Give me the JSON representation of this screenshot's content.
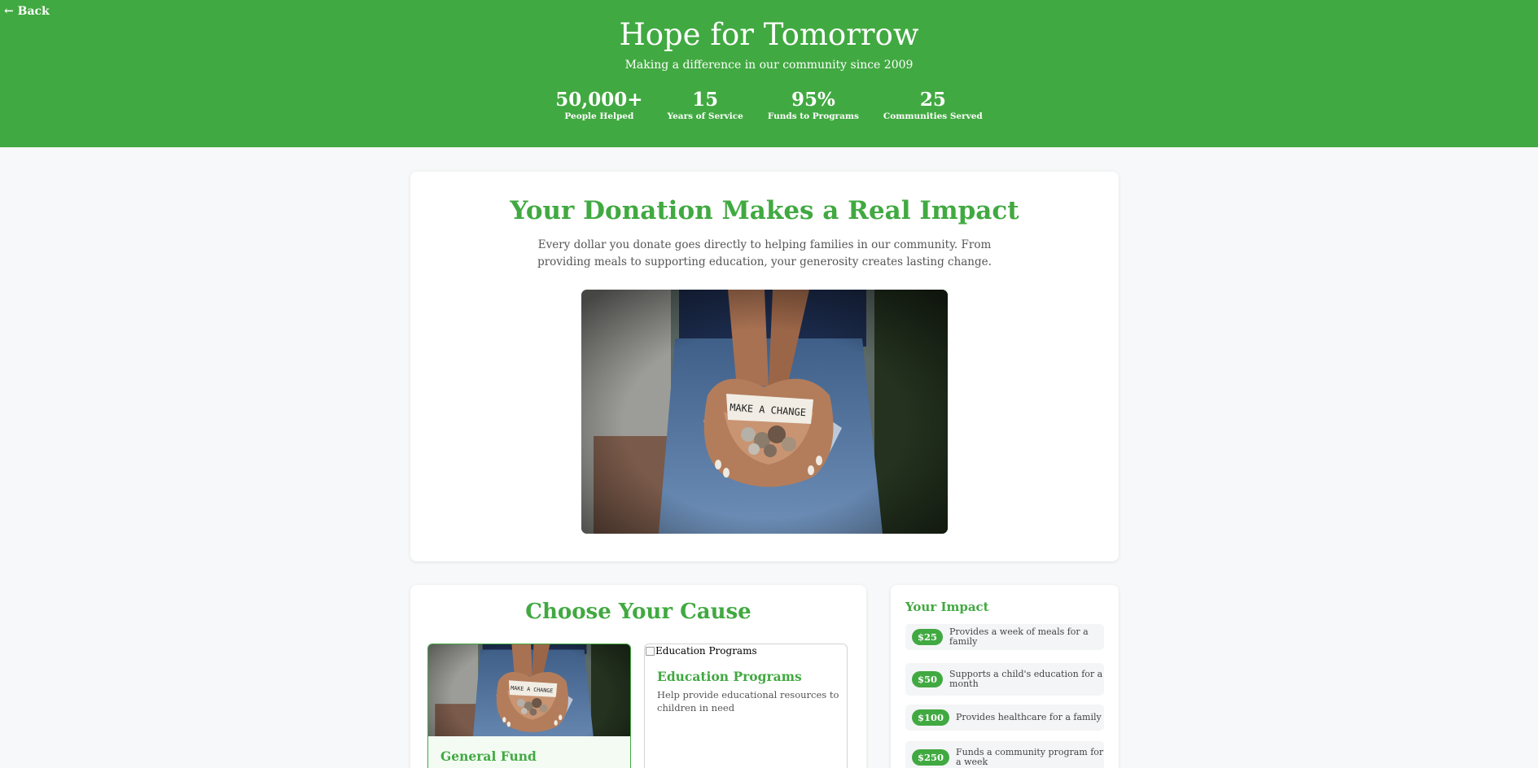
{
  "header": {
    "back_label": "← Back",
    "title": "Hope for Tomorrow",
    "tagline": "Making a difference in our community since 2009",
    "stats": [
      {
        "value": "50,000+",
        "label": "People Helped"
      },
      {
        "value": "15",
        "label": "Years of Service"
      },
      {
        "value": "95%",
        "label": "Funds to Programs"
      },
      {
        "value": "25",
        "label": "Communities Served"
      }
    ]
  },
  "impact": {
    "title": "Your Donation Makes a Real Impact",
    "text": "Every dollar you donate goes directly to helping families in our community. From providing meals to supporting education, your generosity creates lasting change.",
    "photo_note_text": "MAKE A CHANGE"
  },
  "causes": {
    "title": "Choose Your Cause",
    "options": [
      {
        "name": "General Fund",
        "selected": true
      },
      {
        "name": "Education Programs",
        "image_alt": "Education Programs",
        "description": "Help provide educational resources to children in need"
      }
    ]
  },
  "your_impact": {
    "title": "Your Impact",
    "items": [
      {
        "amount": "$25",
        "description": "Provides a week of meals for a family"
      },
      {
        "amount": "$50",
        "description": "Supports a child's education for a month"
      },
      {
        "amount": "$100",
        "description": "Provides healthcare for a family"
      },
      {
        "amount": "$250",
        "description": "Funds a community program for a week"
      }
    ]
  },
  "colors": {
    "brand_green": "#41a941",
    "page_background": "#f7f8f9"
  }
}
